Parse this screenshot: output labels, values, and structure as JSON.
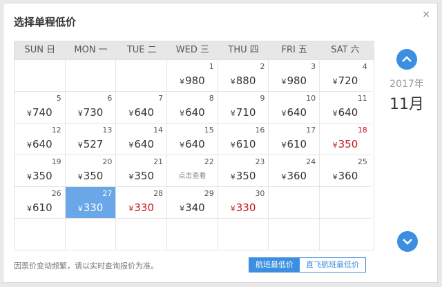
{
  "dialog": {
    "title": "选择单程低价",
    "close_glyph": "×"
  },
  "weekdays": [
    "SUN 日",
    "MON 一",
    "TUE 二",
    "WED 三",
    "THU 四",
    "FRI 五",
    "SAT 六"
  ],
  "side": {
    "year": "2017年",
    "month": "11月"
  },
  "currency": "¥",
  "weeks": [
    [
      {
        "day": "",
        "price": ""
      },
      {
        "day": "",
        "price": ""
      },
      {
        "day": "",
        "price": ""
      },
      {
        "day": "1",
        "price": "980"
      },
      {
        "day": "2",
        "price": "880"
      },
      {
        "day": "3",
        "price": "980"
      },
      {
        "day": "4",
        "price": "720"
      }
    ],
    [
      {
        "day": "5",
        "price": "740"
      },
      {
        "day": "6",
        "price": "730"
      },
      {
        "day": "7",
        "price": "640"
      },
      {
        "day": "8",
        "price": "640"
      },
      {
        "day": "9",
        "price": "710"
      },
      {
        "day": "10",
        "price": "640"
      },
      {
        "day": "11",
        "price": "640"
      }
    ],
    [
      {
        "day": "12",
        "price": "640"
      },
      {
        "day": "13",
        "price": "527"
      },
      {
        "day": "14",
        "price": "640"
      },
      {
        "day": "15",
        "price": "640"
      },
      {
        "day": "16",
        "price": "610"
      },
      {
        "day": "17",
        "price": "610"
      },
      {
        "day": "18",
        "price": "350",
        "red": true,
        "redday": true
      }
    ],
    [
      {
        "day": "19",
        "price": "350"
      },
      {
        "day": "20",
        "price": "350"
      },
      {
        "day": "21",
        "price": "350"
      },
      {
        "day": "22",
        "price": "",
        "text": "点击查看"
      },
      {
        "day": "23",
        "price": "350"
      },
      {
        "day": "24",
        "price": "360"
      },
      {
        "day": "25",
        "price": "360"
      }
    ],
    [
      {
        "day": "26",
        "price": "610"
      },
      {
        "day": "27",
        "price": "330",
        "selected": true
      },
      {
        "day": "28",
        "price": "330",
        "red": true
      },
      {
        "day": "29",
        "price": "340"
      },
      {
        "day": "30",
        "price": "330",
        "red": true
      },
      {
        "day": "",
        "price": ""
      },
      {
        "day": "",
        "price": ""
      }
    ],
    [
      {
        "day": "",
        "price": ""
      },
      {
        "day": "",
        "price": ""
      },
      {
        "day": "",
        "price": ""
      },
      {
        "day": "",
        "price": ""
      },
      {
        "day": "",
        "price": ""
      },
      {
        "day": "",
        "price": ""
      },
      {
        "day": "",
        "price": ""
      }
    ]
  ],
  "footer": {
    "note": "因票价变动频繁，请以实时查询报价为准。",
    "tab_lowest": "航班最低价",
    "tab_direct": "直飞航班最低价"
  }
}
